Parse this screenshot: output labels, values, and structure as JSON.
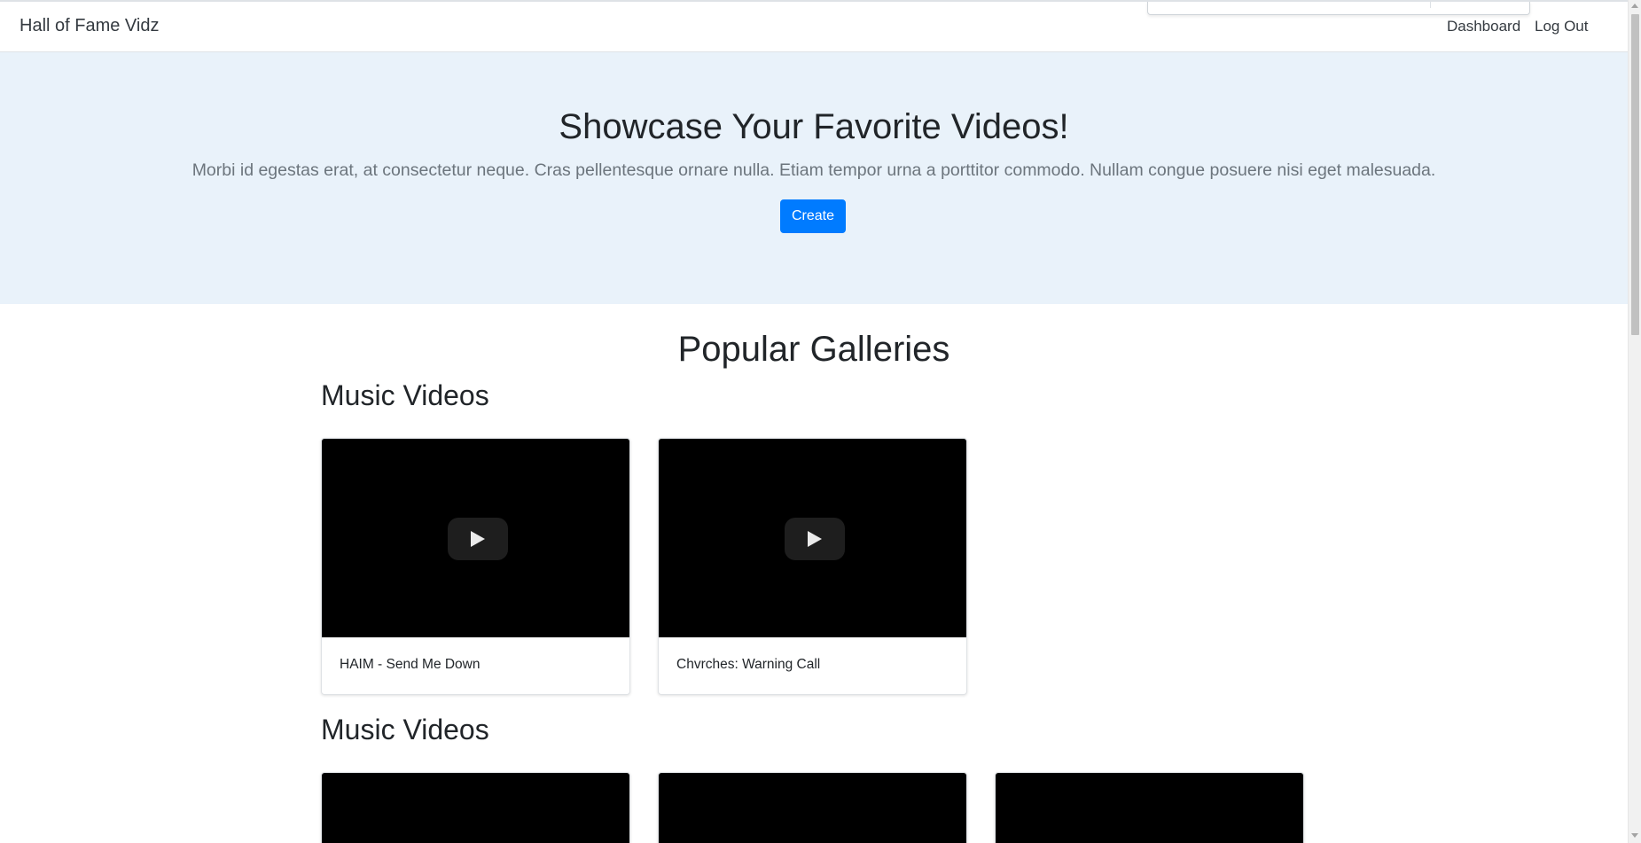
{
  "navbar": {
    "brand": "Hall of Fame Vidz",
    "links": [
      {
        "label": "Dashboard"
      },
      {
        "label": "Log Out"
      }
    ]
  },
  "hero": {
    "title": "Showcase Your Favorite Videos!",
    "lead": "Morbi id egestas erat, at consectetur neque. Cras pellentesque ornare nulla. Etiam tempor urna a porttitor commodo. Nullam congue posuere nisi eget malesuada.",
    "create_label": "Create"
  },
  "galleries_title": "Popular Galleries",
  "galleries": [
    {
      "name": "Music Videos",
      "videos": [
        {
          "title": "HAIM - Send Me Down"
        },
        {
          "title": "Chvrches: Warning Call"
        }
      ]
    },
    {
      "name": "Music Videos",
      "videos": [
        {
          "title": ""
        },
        {
          "title": ""
        },
        {
          "title": ""
        }
      ]
    }
  ],
  "icons": {
    "play": "play-icon"
  },
  "colors": {
    "primary": "#007bff",
    "hero_background": "#e9f2fa",
    "video_background": "#000000",
    "text": "#212529",
    "muted": "#6c757d"
  }
}
